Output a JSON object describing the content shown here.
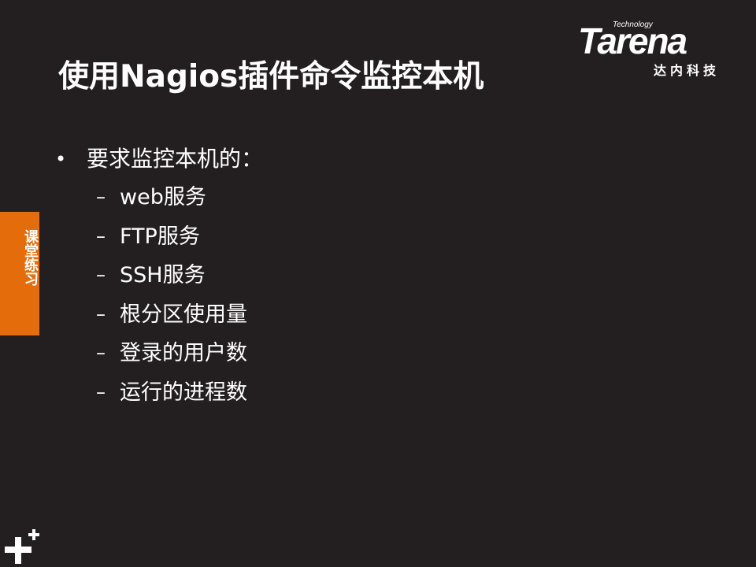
{
  "slide": {
    "title": "使用Nagios插件命令监控本机",
    "logo": {
      "tagline": "Technology",
      "wordmark": "Tarena",
      "subtitle": "达内科技"
    },
    "side_tab": {
      "label": "课堂练习",
      "color": "#e46c0a"
    },
    "bullet": {
      "marker": "•",
      "text": "要求监控本机的："
    },
    "sub_marker": "–",
    "sub_items": [
      "web服务",
      "FTP服务",
      "SSH服务",
      "根分区使用量",
      "登录的用户数",
      "运行的进程数"
    ],
    "background_color": "#231f20",
    "decoration_icon": "plus-sparkle-icon"
  }
}
